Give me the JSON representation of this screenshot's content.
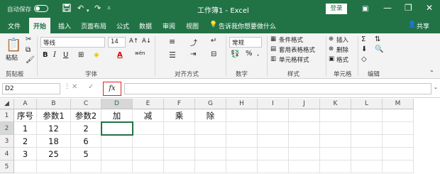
{
  "titlebar": {
    "autosave": "自动保存",
    "off": "关",
    "title": "工作簿1 - Excel",
    "login": "登录",
    "save_icon": "save-icon",
    "undo_icon": "undo-icon",
    "redo_icon": "redo-icon"
  },
  "tabs": [
    "文件",
    "开始",
    "插入",
    "页面布局",
    "公式",
    "数据",
    "审阅",
    "视图"
  ],
  "active_tab": "开始",
  "tell_me": "告诉我你想要做什么",
  "share": "共享",
  "ribbon": {
    "clipboard": {
      "paste": "粘贴",
      "label": "剪贴板"
    },
    "font": {
      "name": "等线",
      "size": "14",
      "bold": "B",
      "italic": "I",
      "underline": "U",
      "label": "字体",
      "grow": "A↑",
      "shrink": "A↓",
      "wen": "wén"
    },
    "alignment": {
      "label": "对齐方式"
    },
    "number": {
      "format": "常规",
      "label": "数字",
      "percent": "%",
      "comma": ","
    },
    "styles": {
      "cond": "条件格式",
      "table": "套用表格格式",
      "cell": "单元格样式",
      "label": "样式"
    },
    "cells": {
      "insert": "插入",
      "delete": "删除",
      "format": "格式",
      "label": "单元格"
    },
    "editing": {
      "sum": "Σ",
      "label": "编辑"
    }
  },
  "formula_bar": {
    "name_box": "D2",
    "fx": "fx",
    "value": ""
  },
  "sheet": {
    "columns": [
      "A",
      "B",
      "C",
      "D",
      "E",
      "F",
      "G",
      "H",
      "I",
      "J",
      "K",
      "L",
      "M"
    ],
    "rows": [
      "1",
      "2",
      "3",
      "4",
      "5"
    ],
    "selected": "D2",
    "cells": [
      [
        "序号",
        "参数1",
        "参数2",
        "加",
        "减",
        "乘",
        "除",
        "",
        "",
        "",
        "",
        "",
        ""
      ],
      [
        "1",
        "12",
        "2",
        "",
        "",
        "",
        "",
        "",
        "",
        "",
        "",
        "",
        ""
      ],
      [
        "2",
        "18",
        "6",
        "",
        "",
        "",
        "",
        "",
        "",
        "",
        "",
        "",
        ""
      ],
      [
        "3",
        "25",
        "5",
        "",
        "",
        "",
        "",
        "",
        "",
        "",
        "",
        "",
        ""
      ],
      [
        "",
        "",
        "",
        "",
        "",
        "",
        "",
        "",
        "",
        "",
        "",
        "",
        ""
      ]
    ]
  }
}
